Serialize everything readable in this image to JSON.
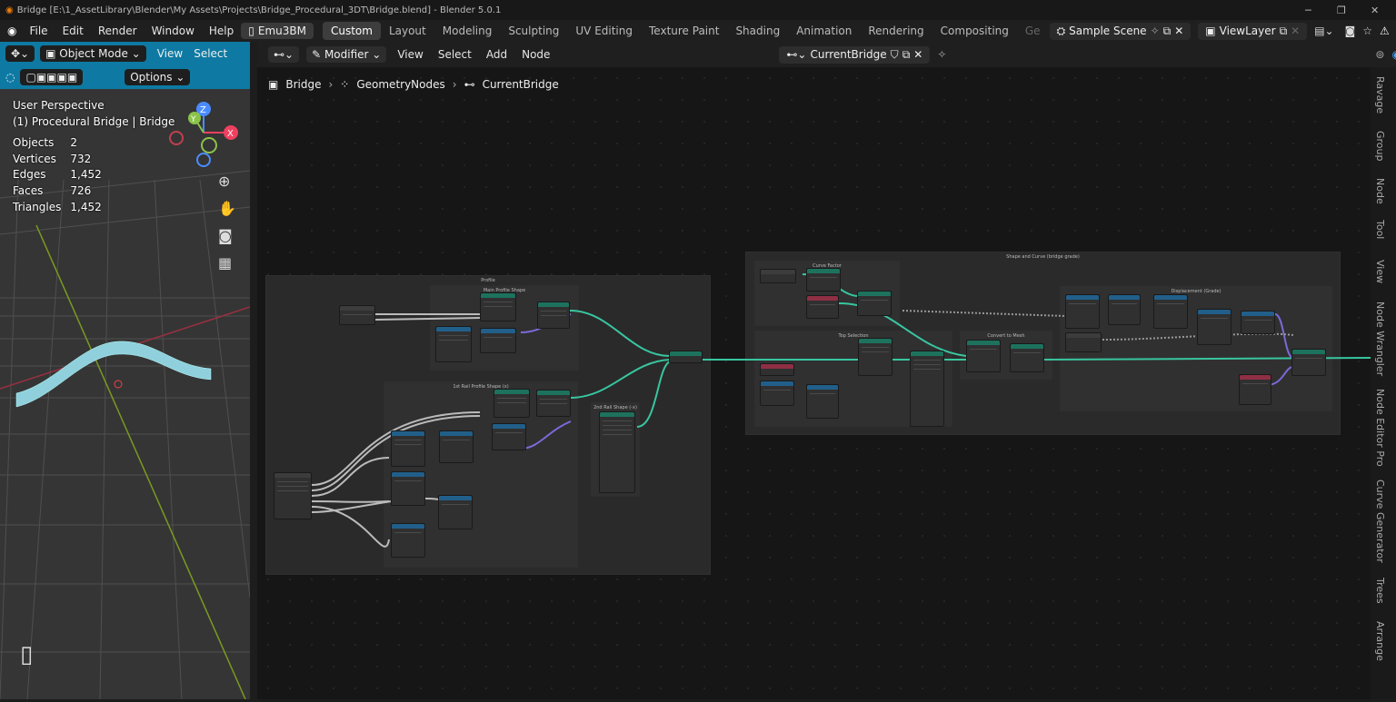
{
  "title": "Bridge [E:\\1_AssetLibrary\\Blender\\My Assets\\Projects\\Bridge_Procedural_3DT\\Bridge.blend] - Blender 5.0.1",
  "menu": [
    "File",
    "Edit",
    "Render",
    "Window",
    "Help"
  ],
  "emu_label": "Emu3BM",
  "workspaces": [
    "Custom",
    "Layout",
    "Modeling",
    "Sculpting",
    "UV Editing",
    "Texture Paint",
    "Shading",
    "Animation",
    "Rendering",
    "Compositing",
    "Ge"
  ],
  "scene": "Sample Scene",
  "view_layer": "ViewLayer",
  "viewport": {
    "mode": "Object Mode",
    "view": "View",
    "select": "Select",
    "options": "Options",
    "perspective": "User Perspective",
    "object": "(1) Procedural Bridge | Bridge",
    "stats": [
      {
        "label": "Objects",
        "value": "2"
      },
      {
        "label": "Vertices",
        "value": "732"
      },
      {
        "label": "Edges",
        "value": "1,452"
      },
      {
        "label": "Faces",
        "value": "726"
      },
      {
        "label": "Triangles",
        "value": "1,452"
      }
    ],
    "axes": {
      "z": "Z",
      "y": "Y",
      "x": "X"
    }
  },
  "node_header": {
    "modifier": "Modifier",
    "menus": [
      "View",
      "Select",
      "Add",
      "Node"
    ],
    "tree": "CurrentBridge"
  },
  "breadcrumb": [
    "Bridge",
    "GeometryNodes",
    "CurrentBridge"
  ],
  "frames": {
    "profile": "Profile",
    "main_profile": "Main Profile Shape",
    "rail1": "1st Rail Profile Shape (x)",
    "rail2": "2nd Rail Shape (-x)",
    "shape_curve": "Shape and Curve (bridge grade)",
    "curve_factor": "Curve Factor",
    "top_sel": "Top Selection",
    "convert": "Convert to Mesh",
    "displacement": "Displacement (Grade)"
  },
  "side_tabs": [
    "Ravage",
    "Group",
    "Node",
    "Tool",
    "View",
    "Node Wrangler",
    "Node Editor Pro",
    "Curve Generator",
    "Trees",
    "Arrange"
  ],
  "colors": {
    "accent": "#0e7aa3",
    "wire": "#38c6a0",
    "header_teal": "#1d725e",
    "header_blue": "#215f8a",
    "header_red": "#8f2f44"
  }
}
